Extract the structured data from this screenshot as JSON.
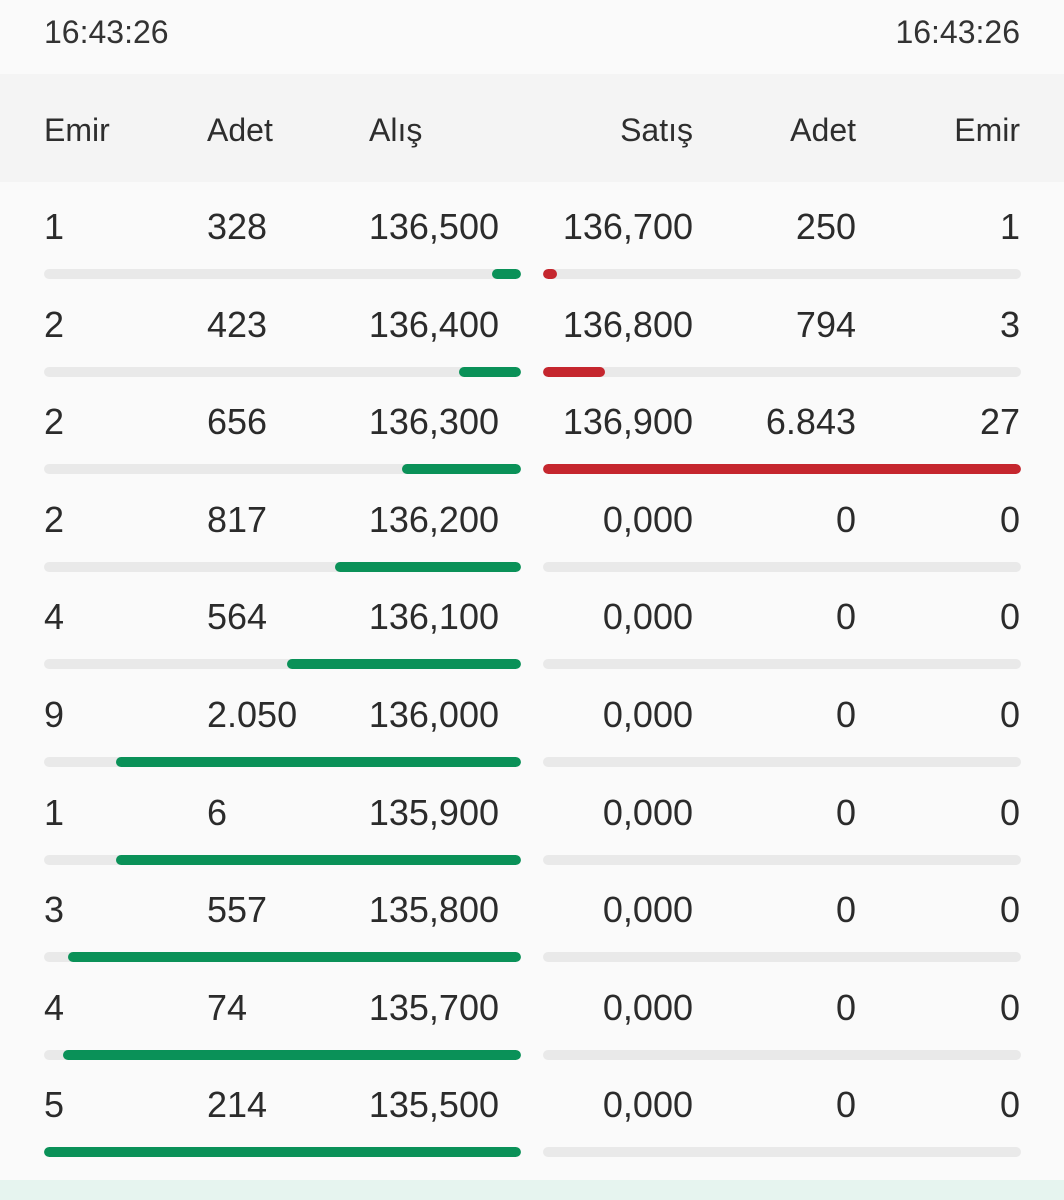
{
  "times": {
    "left": "16:43:26",
    "right": "16:43:26"
  },
  "header": {
    "emir_left": "Emir",
    "adet_left": "Adet",
    "alis": "Alış",
    "satis": "Satış",
    "adet_right": "Adet",
    "emir_right": "Emir"
  },
  "colors": {
    "bid": "#0a9158",
    "ask": "#c5262e",
    "track": "#e9e9e9"
  },
  "rows": [
    {
      "bid_emir": "1",
      "bid_adet": "328",
      "alis": "136,500",
      "satis": "136,700",
      "ask_adet": "250",
      "ask_emir": "1",
      "bid_fill": 0.06,
      "ask_fill": 0.03
    },
    {
      "bid_emir": "2",
      "bid_adet": "423",
      "alis": "136,400",
      "satis": "136,800",
      "ask_adet": "794",
      "ask_emir": "3",
      "bid_fill": 0.13,
      "ask_fill": 0.13
    },
    {
      "bid_emir": "2",
      "bid_adet": "656",
      "alis": "136,300",
      "satis": "136,900",
      "ask_adet": "6.843",
      "ask_emir": "27",
      "bid_fill": 0.25,
      "ask_fill": 1.0
    },
    {
      "bid_emir": "2",
      "bid_adet": "817",
      "alis": "136,200",
      "satis": "0,000",
      "ask_adet": "0",
      "ask_emir": "0",
      "bid_fill": 0.39,
      "ask_fill": 0
    },
    {
      "bid_emir": "4",
      "bid_adet": "564",
      "alis": "136,100",
      "satis": "0,000",
      "ask_adet": "0",
      "ask_emir": "0",
      "bid_fill": 0.49,
      "ask_fill": 0
    },
    {
      "bid_emir": "9",
      "bid_adet": "2.050",
      "alis": "136,000",
      "satis": "0,000",
      "ask_adet": "0",
      "ask_emir": "0",
      "bid_fill": 0.85,
      "ask_fill": 0
    },
    {
      "bid_emir": "1",
      "bid_adet": "6",
      "alis": "135,900",
      "satis": "0,000",
      "ask_adet": "0",
      "ask_emir": "0",
      "bid_fill": 0.85,
      "ask_fill": 0
    },
    {
      "bid_emir": "3",
      "bid_adet": "557",
      "alis": "135,800",
      "satis": "0,000",
      "ask_adet": "0",
      "ask_emir": "0",
      "bid_fill": 0.95,
      "ask_fill": 0
    },
    {
      "bid_emir": "4",
      "bid_adet": "74",
      "alis": "135,700",
      "satis": "0,000",
      "ask_adet": "0",
      "ask_emir": "0",
      "bid_fill": 0.96,
      "ask_fill": 0
    },
    {
      "bid_emir": "5",
      "bid_adet": "214",
      "alis": "135,500",
      "satis": "0,000",
      "ask_adet": "0",
      "ask_emir": "0",
      "bid_fill": 1.0,
      "ask_fill": 0
    }
  ]
}
